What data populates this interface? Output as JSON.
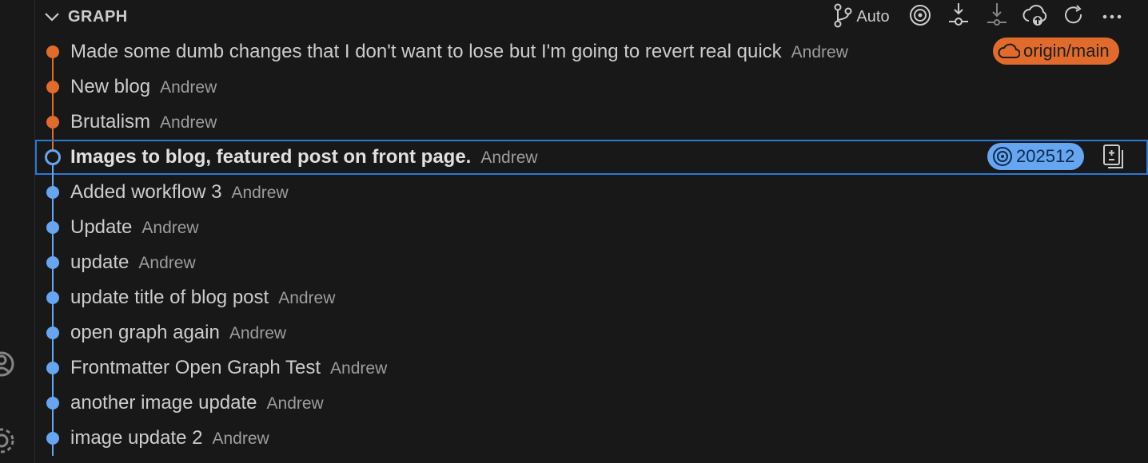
{
  "section": {
    "title": "GRAPH"
  },
  "toolbar": {
    "auto_label": "Auto"
  },
  "colors": {
    "orange": "#e06b2a",
    "blue": "#66a5f0",
    "selected_border": "#2b79d6"
  },
  "commits": [
    {
      "message": "Made some dumb changes that I don't want to lose but I'm going to revert real quick",
      "author": "Andrew",
      "color": "orange",
      "badge": {
        "type": "remote",
        "label": "origin/main",
        "icon": "cloud-icon"
      }
    },
    {
      "message": "New blog",
      "author": "Andrew",
      "color": "orange"
    },
    {
      "message": "Brutalism",
      "author": "Andrew",
      "color": "orange"
    },
    {
      "message": "Images to blog, featured post on front page.",
      "author": "Andrew",
      "color": "blue",
      "selected": true,
      "badge": {
        "type": "tag",
        "label": "202512",
        "icon": "target-icon"
      }
    },
    {
      "message": "Added workflow 3",
      "author": "Andrew",
      "color": "blue"
    },
    {
      "message": "Update",
      "author": "Andrew",
      "color": "blue"
    },
    {
      "message": "update",
      "author": "Andrew",
      "color": "blue"
    },
    {
      "message": "update title of blog post",
      "author": "Andrew",
      "color": "blue"
    },
    {
      "message": "open graph again",
      "author": "Andrew",
      "color": "blue"
    },
    {
      "message": "Frontmatter Open Graph Test",
      "author": "Andrew",
      "color": "blue"
    },
    {
      "message": "another image update",
      "author": "Andrew",
      "color": "blue"
    },
    {
      "message": "image update 2",
      "author": "Andrew",
      "color": "blue"
    }
  ]
}
